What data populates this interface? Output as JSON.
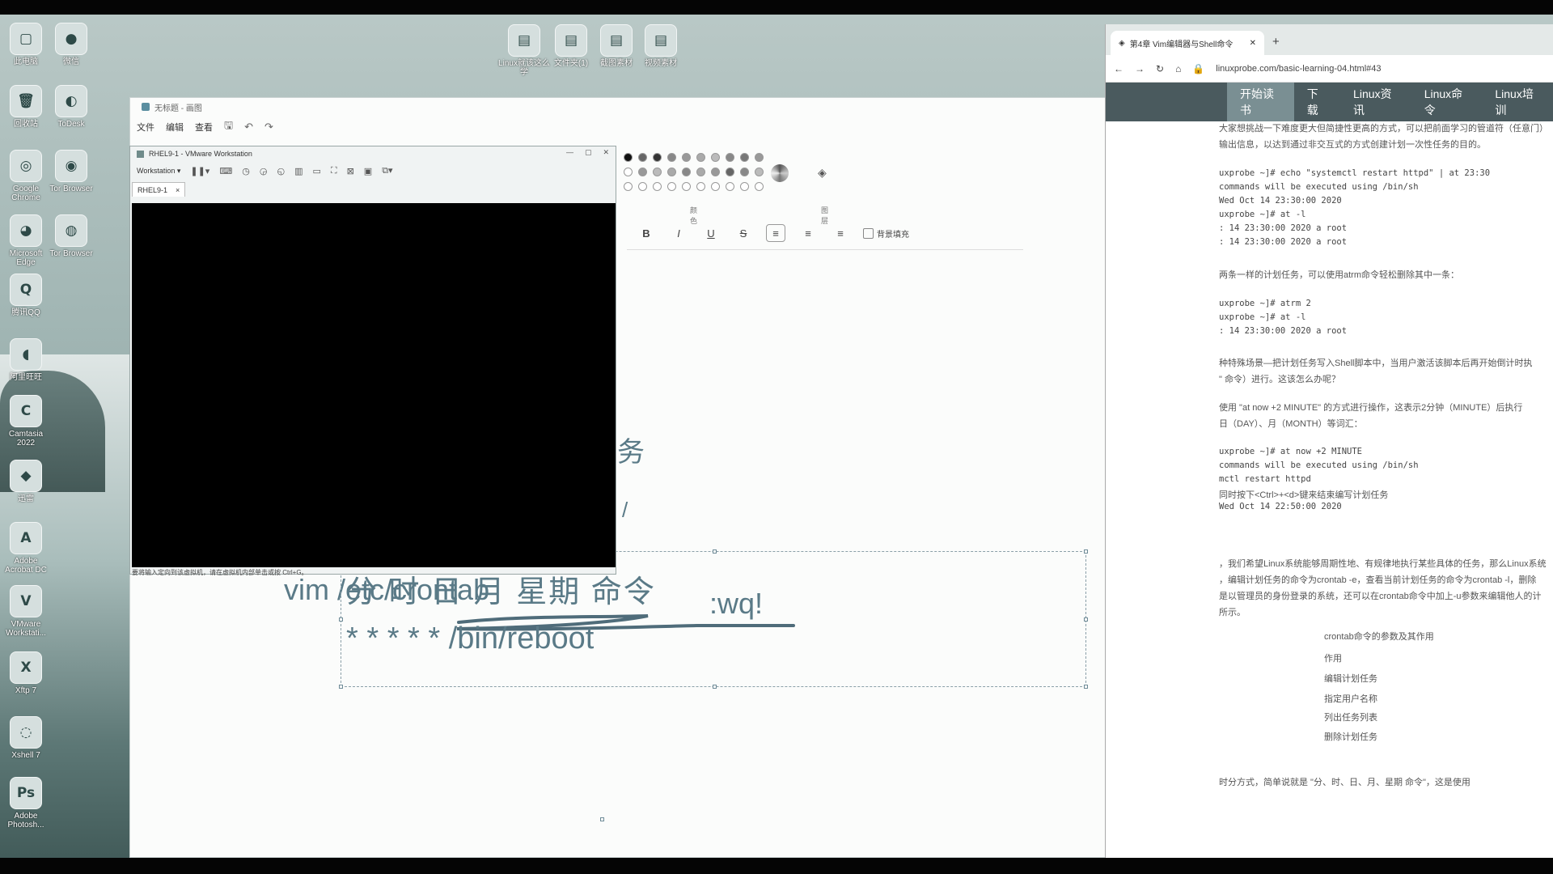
{
  "desktop": {
    "icons_left": [
      {
        "label": "此电脑",
        "glyph": "▢"
      },
      {
        "label": "微信",
        "glyph": "●"
      },
      {
        "label": "回收站",
        "glyph": "🗑"
      },
      {
        "label": "ToDesk",
        "glyph": "◐"
      },
      {
        "label": "Google Chrome",
        "glyph": "◎"
      },
      {
        "label": "Tor Browser",
        "glyph": "◉"
      },
      {
        "label": "Microsoft Edge",
        "glyph": "◕"
      },
      {
        "label": "Tor Browser",
        "glyph": "◍"
      },
      {
        "label": "腾讯QQ",
        "glyph": "Q"
      },
      {
        "label": "阿里旺旺",
        "glyph": "◖"
      },
      {
        "label": "Camtasia 2022",
        "glyph": "C"
      },
      {
        "label": "迅雷",
        "glyph": "◆"
      },
      {
        "label": "Adobe Acrobat DC",
        "glyph": "A"
      },
      {
        "label": "VMware Workstati...",
        "glyph": "V"
      },
      {
        "label": "Xftp 7",
        "glyph": "X"
      },
      {
        "label": "Xshell 7",
        "glyph": "◌"
      },
      {
        "label": "Adobe Photosh...",
        "glyph": "Ps"
      }
    ],
    "icons_top": [
      {
        "label": "Linux就该这么学",
        "glyph": "▤"
      },
      {
        "label": "文件夹(1)",
        "glyph": "▤"
      },
      {
        "label": "截图素材",
        "glyph": "▤"
      },
      {
        "label": "视频素材",
        "glyph": "▤"
      }
    ]
  },
  "paint": {
    "title": "无标题 - 画图",
    "menu": [
      "文件",
      "编辑",
      "查看"
    ],
    "palette_label": "颜色",
    "layers_label": "图层",
    "format": {
      "bold": "B",
      "italic": "I",
      "underline": "U",
      "strike": "S",
      "bg_fill": "背景填充"
    },
    "canvas": {
      "partial_1": "务",
      "partial_2": "/",
      "cmd": "vim /etc/crontab",
      "wq": ":wq!",
      "line1": "分 时 日 月 星期 命令",
      "line2": "* * * * * /bin/reboot"
    }
  },
  "vmware": {
    "title": "RHEL9-1 - VMware Workstation",
    "menu": "Workstation ▾",
    "tab": "RHEL9-1",
    "status": "要将输入定向到该虚拟机，请在虚拟机内部单击或按 Ctrl+G。"
  },
  "browser": {
    "tab_title": "第4章 Vim编辑器与Shell命令",
    "url": "linuxprobe.com/basic-learning-04.html#43",
    "nav": [
      "开始读书",
      "下载",
      "Linux资讯",
      "Linux命令",
      "Linux培训"
    ],
    "body": [
      "大家想挑战一下难度更大但简捷性更高的方式，可以把前面学习的管道符（任意门）",
      "输出信息，以达到通过非交互式的方式创建计划一次性任务的目的。",
      "uxprobe ~]# echo \"systemctl restart httpd\" | at 23:30",
      "commands will be executed using /bin/sh",
      "Wed Oct 14 23:30:00 2020",
      "uxprobe ~]# at -l",
      ": 14 23:30:00 2020 a root",
      ": 14 23:30:00 2020 a root",
      "两条一样的计划任务，可以使用atrm命令轻松删除其中一条：",
      "uxprobe ~]# atrm 2",
      "uxprobe ~]# at -l",
      ": 14 23:30:00 2020 a root",
      "种特殊场景—把计划任务写入Shell脚本中，当用户激活该脚本后再开始倒计时执",
      "\" 命令）进行。这该怎么办呢？",
      "使用 \"at now +2 MINUTE\" 的方式进行操作，这表示2分钟（MINUTE）后执行",
      "日（DAY）、月（MONTH）等词汇：",
      "uxprobe ~]# at now +2 MINUTE",
      "commands will be executed using /bin/sh",
      "mctl restart httpd",
      "同时按下<Ctrl>+<d>键来结束编写计划任务",
      "Wed Oct 14 22:50:00 2020",
      "，我们希望Linux系统能够周期性地、有规律地执行某些具体的任务，那么Linux系统",
      "，编辑计划任务的命令为crontab -e，查看当前计划任务的命令为crontab -l，删除",
      "是以管理员的身份登录的系统，还可以在crontab命令中加上-u参数来编辑他人的计",
      "所示。",
      "crontab命令的参数及其作用",
      "作用",
      "编辑计划任务",
      "指定用户名称",
      "列出任务列表",
      "删除计划任务",
      "时分方式，简单说就是 \"分、时、日、月、星期 命令\"，这是使用"
    ]
  }
}
